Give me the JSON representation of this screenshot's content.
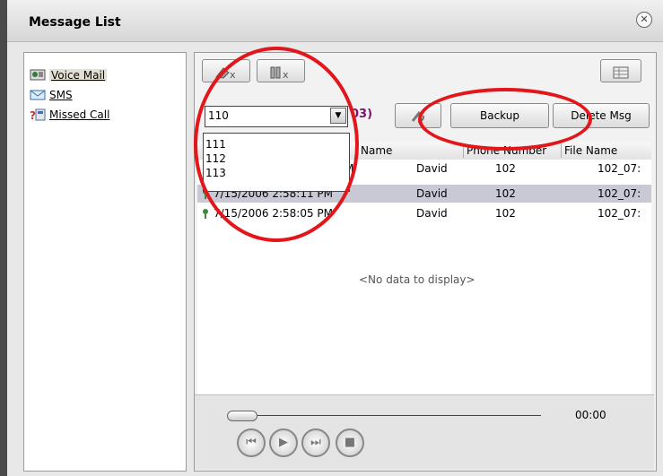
{
  "window": {
    "title": "Message List"
  },
  "nav": {
    "items": [
      {
        "label": "Voice Mail",
        "icon": "voicemail-icon",
        "active": true
      },
      {
        "label": "SMS",
        "icon": "envelope-icon",
        "active": false
      },
      {
        "label": "Missed Call",
        "icon": "missed-call-icon",
        "active": false
      }
    ]
  },
  "toolbar": {
    "backup_label": "Backup",
    "delete_label": "Delete Msg",
    "count_suffix": "03)"
  },
  "combo": {
    "value": "110",
    "options": [
      "111",
      "112",
      "113"
    ]
  },
  "table": {
    "columns": [
      "Name",
      "Phone Number",
      "File Name"
    ],
    "rows": [
      {
        "date": "M",
        "name": "David",
        "phone": "102",
        "file": "102_07:"
      },
      {
        "date": "7/15/2006 2:58:11 PM",
        "name": "David",
        "phone": "102",
        "file": "102_07:"
      },
      {
        "date": "7/15/2006 2:58:05 PM",
        "name": "David",
        "phone": "102",
        "file": "102_07:"
      }
    ],
    "no_data": "<No data to display>"
  },
  "player": {
    "time": "00:00"
  },
  "colors": {
    "annotation": "#e2161b",
    "count_text": "#80106e",
    "selected_row": "#c9c9d6"
  }
}
